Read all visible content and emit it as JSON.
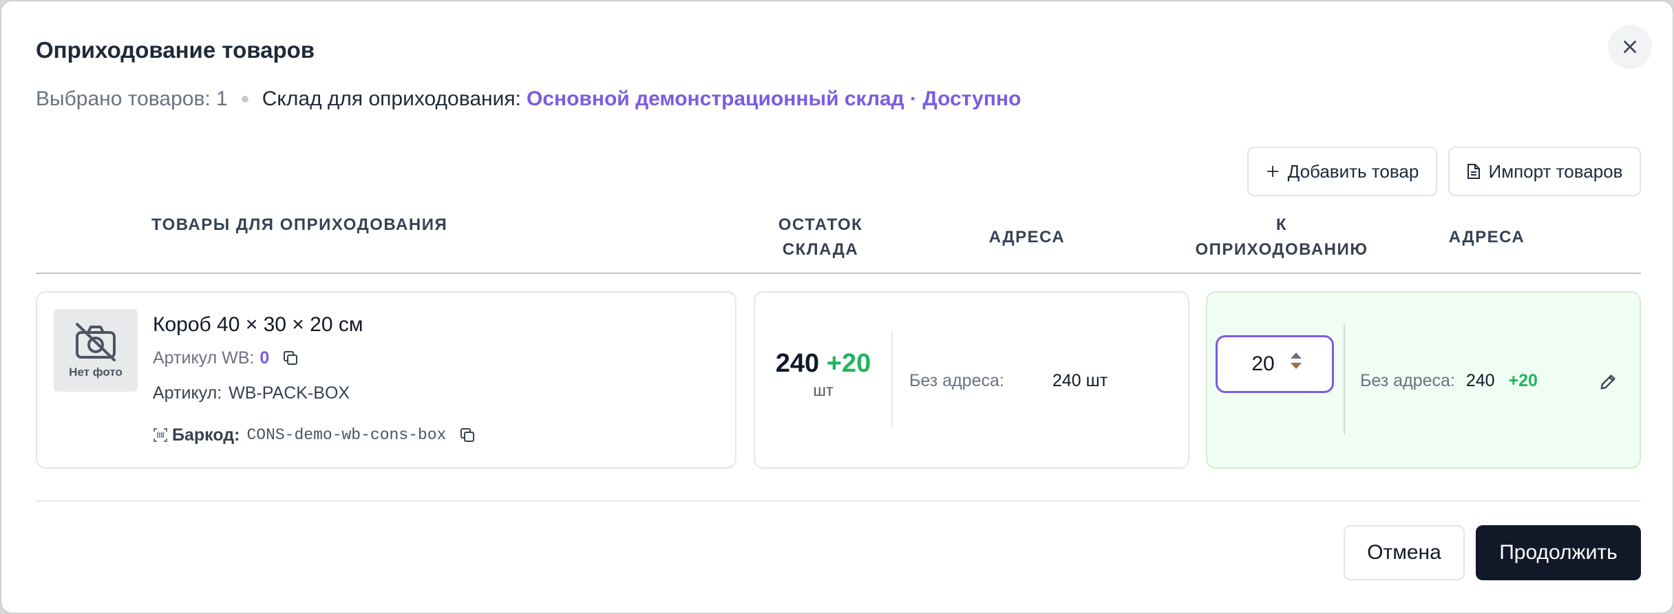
{
  "modal": {
    "title": "Оприходование товаров",
    "selected_count_text": "Выбрано товаров: 1",
    "warehouse_label": "Склад для оприходования:",
    "warehouse_name": "Основной демонстрационный склад · Доступно"
  },
  "toolbar": {
    "add_product_label": "Добавить товар",
    "import_products_label": "Импорт товаров"
  },
  "table": {
    "headers": {
      "products": "ТОВАРЫ ДЛЯ ОПРИХОДОВАНИЯ",
      "stock_line1": "ОСТАТОК",
      "stock_line2": "СКЛАДА",
      "addresses": "АДРЕСА",
      "qty_line1": "К",
      "qty_line2": "ОПРИХОДОВАНИЮ",
      "addresses2": "АДРЕСА"
    },
    "rows": [
      {
        "photo_placeholder": "Нет фото",
        "name": "Короб 40 × 30 × 20 см",
        "wb_article_label": "Артикул WB:",
        "wb_article_value": "0",
        "article_label": "Артикул:",
        "article_value": "WB-PACK-BOX",
        "barcode_label": "Баркод:",
        "barcode_value": "CONS-demo-wb-cons-box",
        "stock": "240",
        "stock_increment": "+20",
        "stock_unit": "шт",
        "stock_address_label": "Без адреса:",
        "stock_address_value": "240 шт",
        "qty_value": "20",
        "qty_address_label": "Без адреса:",
        "qty_address_value": "240",
        "qty_address_increment": "+20"
      }
    ]
  },
  "footer": {
    "cancel_label": "Отмена",
    "continue_label": "Продолжить"
  },
  "colors": {
    "accent": "#7c5ce0",
    "success": "#22b35e",
    "primary_button": "#111827",
    "qty_card_bg": "#effdf3"
  },
  "icons": [
    "close-icon",
    "plus-icon",
    "document-icon",
    "no-photo-icon",
    "copy-icon",
    "barcode-icon",
    "chevron-up-icon",
    "chevron-down-icon",
    "pencil-icon"
  ]
}
